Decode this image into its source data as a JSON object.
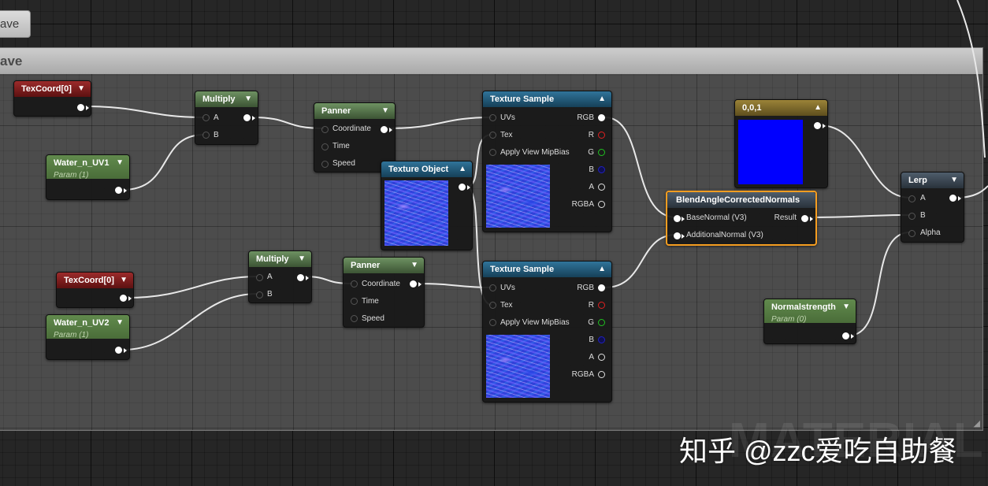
{
  "window": {
    "top_button_label": "ave",
    "comment_title": "ave",
    "watermark_faint": "MATERIAL",
    "watermark": "知乎 @zzc爱吃自助餐"
  },
  "colors": {
    "comment_bg": "#4c4c4c",
    "selected_outline": "#f59d20",
    "constant_color": "#0000ff",
    "wire": "#ffffff"
  },
  "nodes": {
    "texcoord1": {
      "title": "TexCoord[0]"
    },
    "water_uv1": {
      "title": "Water_n_UV1",
      "subtitle": "Param (1)"
    },
    "multiply1": {
      "title": "Multiply",
      "pin_a": "A",
      "pin_b": "B"
    },
    "panner1": {
      "title": "Panner",
      "coordinate": "Coordinate",
      "time": "Time",
      "speed": "Speed"
    },
    "texobject": {
      "title": "Texture Object"
    },
    "texsample1": {
      "title": "Texture Sample",
      "uvs": "UVs",
      "tex": "Tex",
      "mipbias": "Apply View MipBias",
      "rgb": "RGB",
      "r": "R",
      "g": "G",
      "b": "B",
      "a": "A",
      "rgba": "RGBA"
    },
    "texcoord2": {
      "title": "TexCoord[0]"
    },
    "water_uv2": {
      "title": "Water_n_UV2",
      "subtitle": "Param (1)"
    },
    "multiply2": {
      "title": "Multiply",
      "pin_a": "A",
      "pin_b": "B"
    },
    "panner2": {
      "title": "Panner",
      "coordinate": "Coordinate",
      "time": "Time",
      "speed": "Speed"
    },
    "texsample2": {
      "title": "Texture Sample",
      "uvs": "UVs",
      "tex": "Tex",
      "mipbias": "Apply View MipBias",
      "rgb": "RGB",
      "r": "R",
      "g": "G",
      "b": "B",
      "a": "A",
      "rgba": "RGBA"
    },
    "constant": {
      "title": "0,0,1"
    },
    "blend": {
      "title": "BlendAngleCorrectedNormals",
      "base": "BaseNormal (V3)",
      "additional": "AdditionalNormal (V3)",
      "result": "Result"
    },
    "normalstrength": {
      "title": "Normalstrength",
      "subtitle": "Param (0)"
    },
    "lerp": {
      "title": "Lerp",
      "a": "A",
      "b": "B",
      "alpha": "Alpha"
    }
  }
}
